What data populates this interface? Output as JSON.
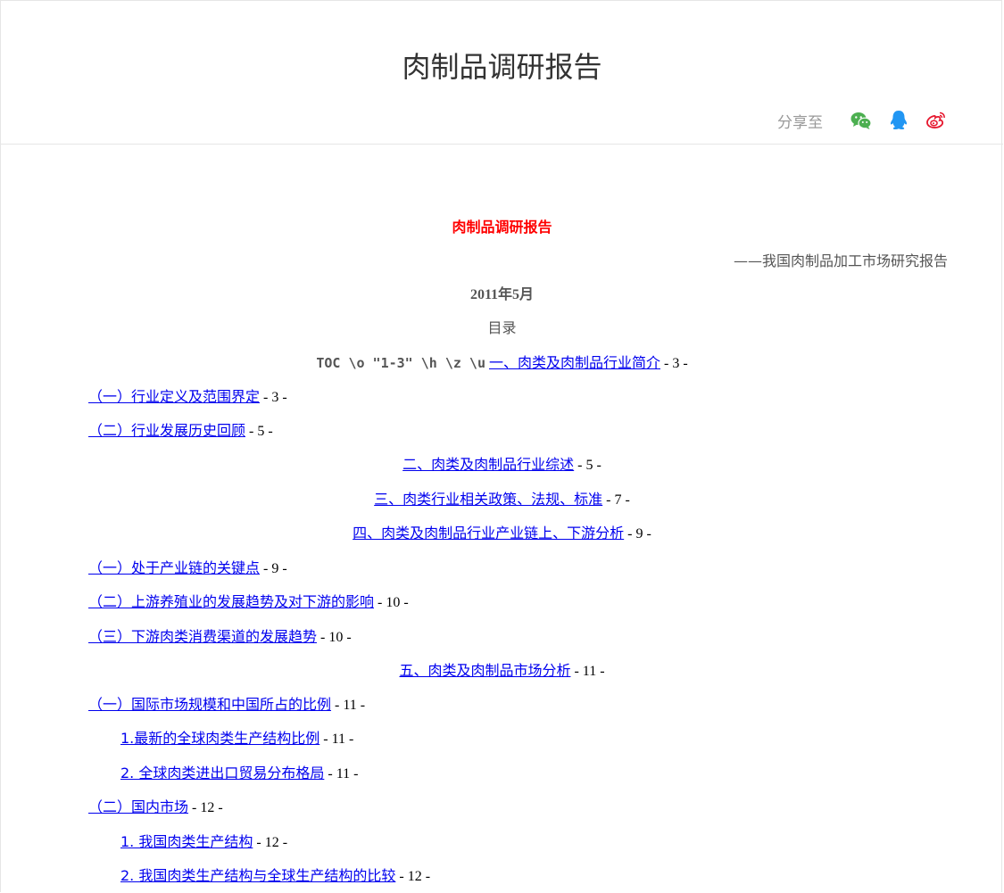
{
  "header": {
    "title": "肉制品调研报告",
    "share_label": "分享至",
    "share_icons": [
      "wechat-icon",
      "qq-icon",
      "weibo-icon"
    ]
  },
  "doc": {
    "title": "肉制品调研报告",
    "subtitle": "——我国肉制品加工市场研究报告",
    "date": "2011年5月",
    "toc_heading": "目录",
    "toc_field_code": "TOC \\o \"1-3\" \\h \\z \\u",
    "toc": [
      {
        "text": "一、肉类及肉制品行业简介",
        "page": " - 3 -"
      },
      {
        "text": "（一）行业定义及范围界定",
        "page": " - 3 -"
      },
      {
        "text": "（二）行业发展历史回顾",
        "page": " - 5 -"
      },
      {
        "text": "二、肉类及肉制品行业综述",
        "page": " - 5 -"
      },
      {
        "text": "三、肉类行业相关政策、法规、标准",
        "page": " - 7 -"
      },
      {
        "text": "四、肉类及肉制品行业产业链上、下游分析",
        "page": " - 9 -"
      },
      {
        "text": "（一）处于产业链的关键点",
        "page": " - 9 -"
      },
      {
        "text": "（二）上游养殖业的发展趋势及对下游的影响",
        "page": " - 10 -"
      },
      {
        "text": "（三）下游肉类消费渠道的发展趋势",
        "page": " - 10 -"
      },
      {
        "text": "五、肉类及肉制品市场分析",
        "page": " - 11 -"
      },
      {
        "text": "（一）国际市场规模和中国所占的比例",
        "page": " - 11 -"
      },
      {
        "text": "1.最新的全球肉类生产结构比例",
        "page": " - 11 -"
      },
      {
        "text": "2.  全球肉类进出口贸易分布格局",
        "page": " - 11 -"
      },
      {
        "text": "（二）国内市场",
        "page": " - 12 -"
      },
      {
        "text": "1.  我国肉类生产结构",
        "page": " - 12 -"
      },
      {
        "text": "2.  我国肉类生产结构与全球生产结构的比较",
        "page": " - 12 -"
      }
    ]
  },
  "colors": {
    "title_red": "#ff0000",
    "link_blue": "#0000ee",
    "wechat_green": "#4caf50",
    "qq_blue": "#2196f3",
    "weibo_red": "#e6162d"
  }
}
